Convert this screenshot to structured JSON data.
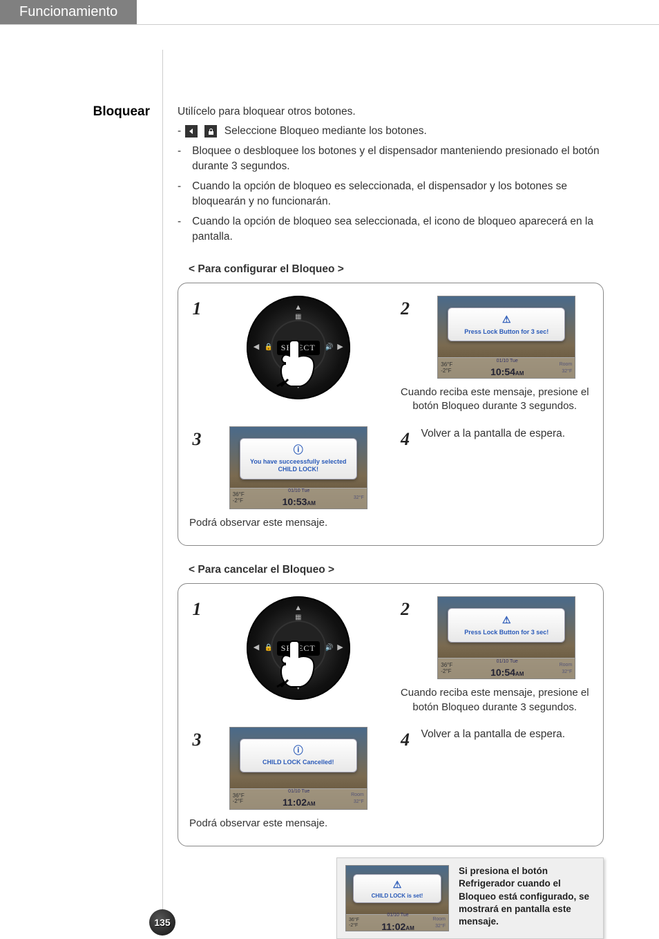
{
  "header": {
    "tab": "Funcionamiento"
  },
  "side_heading": "Bloquear",
  "intro": {
    "lead": "Utilícelo para bloquear otros botones.",
    "items": [
      {
        "text": "Seleccione Bloqueo mediante los botones.",
        "with_icons": true
      },
      {
        "text": "Bloquee o desbloquee los botones y el dispensador manteniendo presionado el botón durante 3 segundos."
      },
      {
        "text": "Cuando la opción de bloqueo es seleccionada, el dispensador y los botones se bloquearán y no funcionarán."
      },
      {
        "text": "Cuando la opción de bloqueo sea seleccionada, el icono de bloqueo aparecerá en la pantalla."
      }
    ]
  },
  "dial_select": "SELECT",
  "section1": {
    "title": "< Para configurar el Bloqueo >",
    "steps": {
      "s1": {
        "num": "1"
      },
      "s2": {
        "num": "2",
        "popup": "Press Lock Button for 3 sec!",
        "bar": {
          "t1": "36°F",
          "t2": "-2°F",
          "date": "01/10 Tue",
          "time": "10:54",
          "ampm": "AM",
          "room": "Room",
          "roomt": "32°F"
        },
        "caption": "Cuando reciba este mensaje, presione el botón Bloqueo durante 3 segundos."
      },
      "s3": {
        "num": "3",
        "popup": "You have succeessfully selected CHILD LOCK!",
        "bar": {
          "t1": "36°F",
          "t2": "-2°F",
          "date": "01/10 Tue",
          "time": "10:53",
          "ampm": "AM",
          "room": "",
          "roomt": "32°F"
        },
        "caption": "Podrá observar este mensaje."
      },
      "s4": {
        "num": "4",
        "caption": "Volver a la pantalla de espera."
      }
    }
  },
  "section2": {
    "title": "< Para cancelar el Bloqueo >",
    "steps": {
      "s1": {
        "num": "1"
      },
      "s2": {
        "num": "2",
        "popup": "Press Lock Button for 3 sec!",
        "bar": {
          "t1": "36°F",
          "t2": "-2°F",
          "date": "01/10 Tue",
          "time": "10:54",
          "ampm": "AM",
          "room": "Room",
          "roomt": "32°F"
        },
        "caption": "Cuando reciba este mensaje, presione el botón Bloqueo durante 3 segundos."
      },
      "s3": {
        "num": "3",
        "popup": "CHILD LOCK Cancelled!",
        "bar": {
          "t1": "36°F",
          "t2": "-2°F",
          "date": "01/10 Tue",
          "time": "11:02",
          "ampm": "AM",
          "room": "Room",
          "roomt": "32°F"
        },
        "caption": "Podrá observar este mensaje."
      },
      "s4": {
        "num": "4",
        "caption": "Volver a la pantalla de espera."
      }
    }
  },
  "note": {
    "popup": "CHILD LOCK is set!",
    "bar": {
      "t1": "36°F",
      "t2": "-2°F",
      "date": "01/10 Tue",
      "time": "11:02",
      "ampm": "AM",
      "room": "Room",
      "roomt": "32°F"
    },
    "text": "Si presiona el botón Refrigerador cuando el Bloqueo está configurado, se mostrará en pantalla este mensaje."
  },
  "page_num": "135"
}
